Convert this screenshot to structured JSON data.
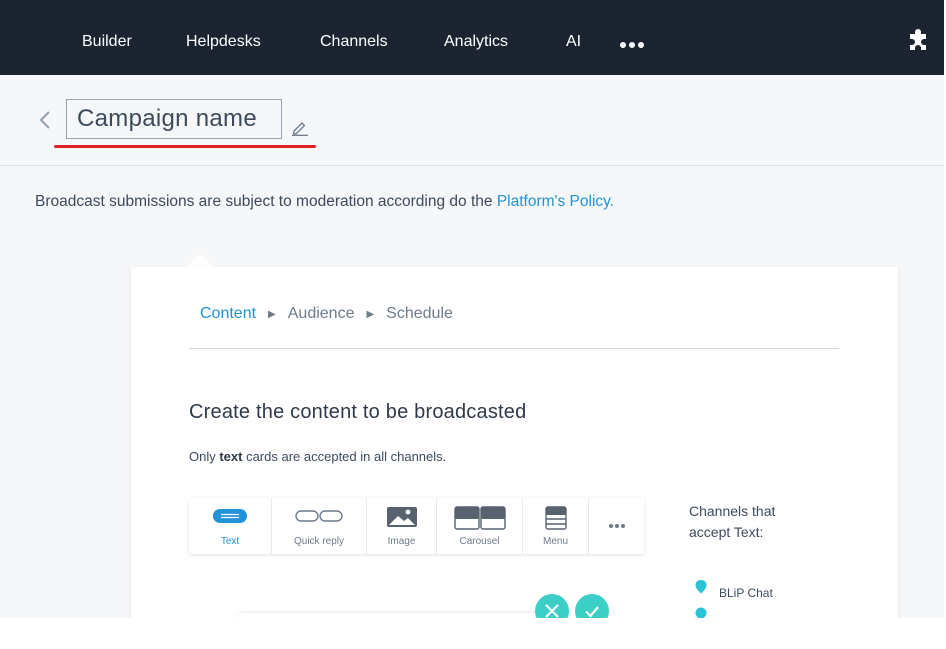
{
  "nav": {
    "items": [
      "Builder",
      "Helpdesks",
      "Channels",
      "Analytics",
      "AI"
    ],
    "more_icon": "ellipsis-icon",
    "extensions_icon": "puzzle-icon"
  },
  "campaign": {
    "name": "Campaign name"
  },
  "notice": {
    "text": "Broadcast submissions are subject to moderation according do the ",
    "link": "Platform's Policy."
  },
  "steps": [
    "Content",
    "Audience",
    "Schedule"
  ],
  "content": {
    "heading": "Create the content to be broadcasted",
    "sub_prefix": "Only ",
    "sub_bold": "text",
    "sub_suffix": " cards are accepted in all channels."
  },
  "card_types": [
    "Text",
    "Quick reply",
    "Image",
    "Carousel",
    "Menu"
  ],
  "channels": {
    "title_line1": "Channels that",
    "title_line2": "accept Text:",
    "items": [
      "BLiP Chat"
    ]
  },
  "colors": {
    "nav_bg": "#1c2432",
    "accent": "#2293d8",
    "teal": "#3ccfc6",
    "highlight": "#e0232b"
  }
}
